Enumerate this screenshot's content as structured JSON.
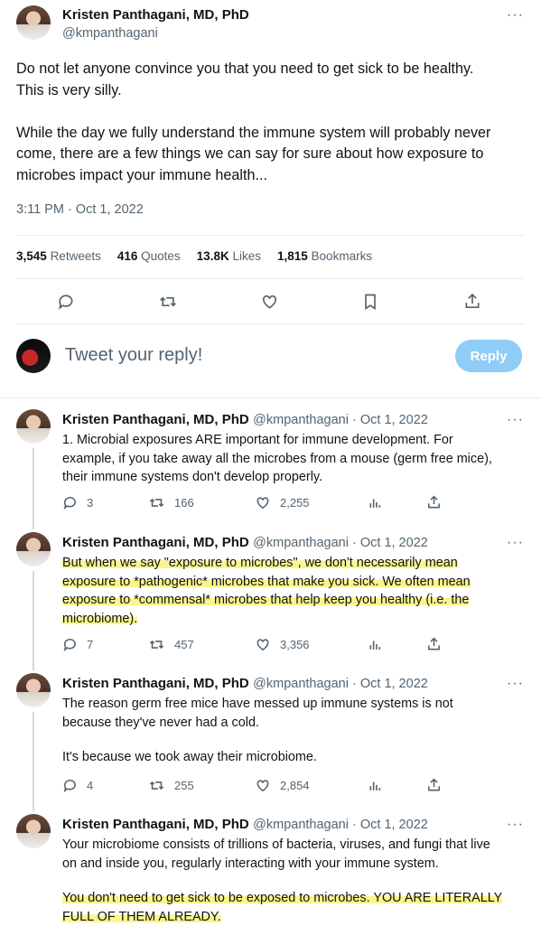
{
  "main_tweet": {
    "author_name": "Kristen Panthagani, MD, PhD",
    "author_handle": "@kmpanthagani",
    "more": "···",
    "paragraph_1_line_1": "Do not let anyone convince you that you need to get sick to be healthy.",
    "paragraph_1_line_2": "This is very silly.",
    "paragraph_2_line_1": "While the day we fully understand the immune system will probably never",
    "paragraph_2_line_2": "come, there are a few things we can say for sure about how exposure to",
    "paragraph_2_line_3": "microbes impact your immune health...",
    "timestamp": "3:11 PM · Oct 1, 2022",
    "stats": {
      "retweets_count": "3,545",
      "retweets_label": "Retweets",
      "quotes_count": "416",
      "quotes_label": "Quotes",
      "likes_count": "13.8K",
      "likes_label": "Likes",
      "bookmarks_count": "1,815",
      "bookmarks_label": "Bookmarks"
    }
  },
  "composer": {
    "placeholder": "Tweet your reply!",
    "reply_button": "Reply"
  },
  "replies": [
    {
      "author_name": "Kristen Panthagani, MD, PhD",
      "meta": "@kmpanthagani · Oct 1, 2022",
      "lines": [
        "1. Microbial exposures ARE important for immune development. For",
        "example, if you take away all the microbes from a mouse (germ free mice),",
        "their immune systems don't develop properly."
      ],
      "replies": "3",
      "retweets": "166",
      "likes": "2,255"
    },
    {
      "author_name": "Kristen Panthagani, MD, PhD",
      "meta": "@kmpanthagani · Oct 1, 2022",
      "lines": [
        "But when we say \"exposure to microbes\", we don't necessarily mean",
        "exposure to *pathogenic* microbes that make you sick. We often mean",
        "exposure to *commensal* microbes that help keep you healthy (i.e. the",
        "microbiome)."
      ],
      "replies": "7",
      "retweets": "457",
      "likes": "3,356"
    },
    {
      "author_name": "Kristen Panthagani, MD, PhD",
      "meta": "@kmpanthagani · Oct 1, 2022",
      "lines": [
        "The reason germ free mice have messed up immune systems is not",
        "because they've never had a cold.",
        "It's because we took away their microbiome."
      ],
      "replies": "4",
      "retweets": "255",
      "likes": "2,854"
    },
    {
      "author_name": "Kristen Panthagani, MD, PhD",
      "meta": "@kmpanthagani · Oct 1, 2022",
      "lines": [
        "Your microbiome consists of trillions of bacteria, viruses, and fungi that live",
        "on and inside you, regularly interacting with your immune system.",
        "You don't need to get sick to be exposed to microbes. YOU ARE LITERALLY",
        "FULL OF THEM ALREADY."
      ]
    }
  ],
  "colors": {
    "accent": "#1d9bf0",
    "reply_button": "#8ecdf8",
    "highlight": "#fbf58a",
    "muted": "#536471"
  }
}
